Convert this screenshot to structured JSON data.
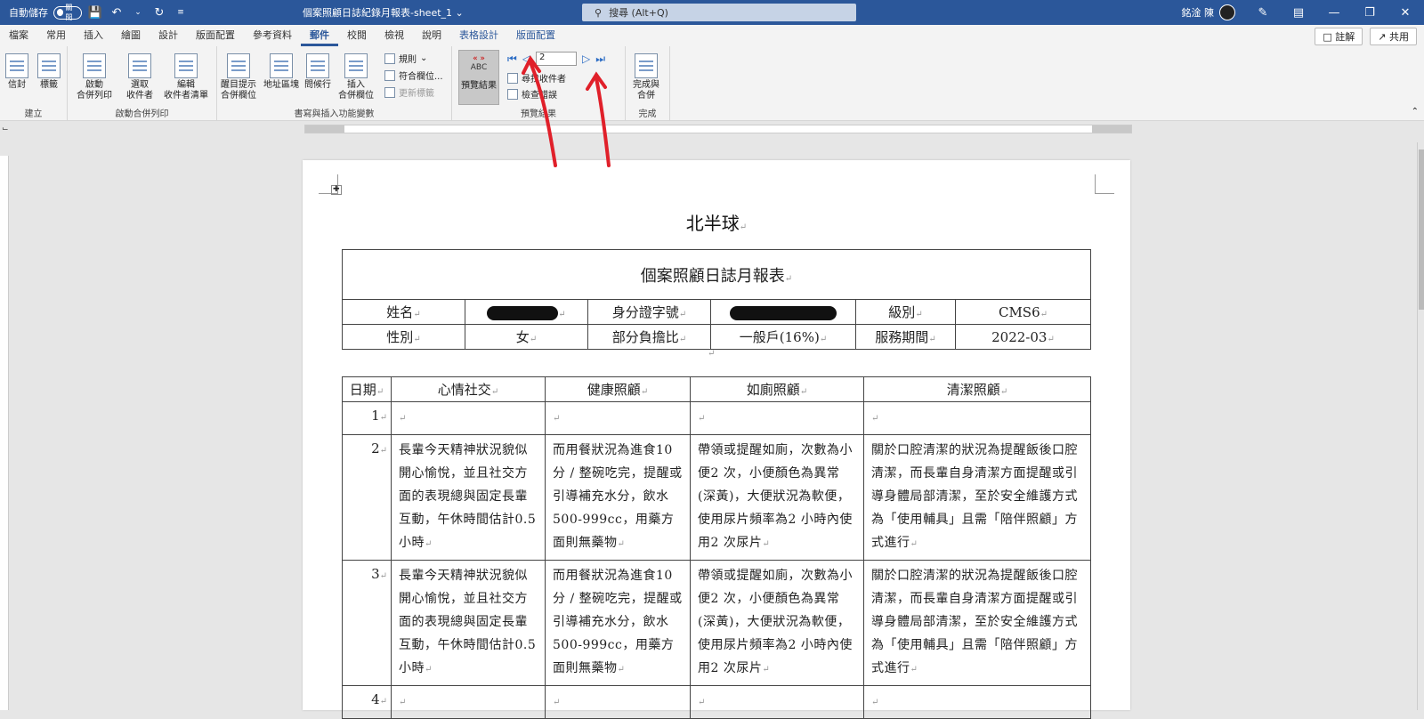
{
  "titlebar": {
    "autosave_label": "自動儲存",
    "autosave_state": "關閉",
    "doc_title": "個案照顧日誌紀錄月報表-sheet_1",
    "search_placeholder": "搜尋 (Alt+Q)",
    "user_name": "銘淦 陳",
    "bg_color": "#2b579a"
  },
  "menu": {
    "items": [
      "檔案",
      "常用",
      "插入",
      "繪圖",
      "設計",
      "版面配置",
      "參考資料",
      "郵件",
      "校閱",
      "檢視",
      "說明",
      "表格設計",
      "版面配置"
    ],
    "active_index": 7,
    "comment_label": "註解",
    "share_label": "共用"
  },
  "ribbon": {
    "create": {
      "label": "建立",
      "envelope": "信封",
      "labels": "標籤"
    },
    "start": {
      "label": "啟動合併列印",
      "start_merge": "啟動\n合併列印",
      "select_recipients": "選取\n收件者",
      "edit_list": "編輯\n收件者清單"
    },
    "fields": {
      "label": "書寫與插入功能變數",
      "highlight": "醒目提示\n合併欄位",
      "address_block": "地址區塊",
      "greeting": "問候行",
      "insert_field": "插入\n合併欄位",
      "rules": "規則",
      "match_fields": "符合欄位...",
      "update_labels": "更新標籤"
    },
    "preview": {
      "label": "預覽結果",
      "preview_button": "預覽結果",
      "record_value": "2",
      "find_recipient": "尋找收件者",
      "check_errors": "檢查錯誤"
    },
    "finish": {
      "label": "完成",
      "finish_merge": "完成與\n合併"
    }
  },
  "document": {
    "heading": "北半球",
    "table1": {
      "title": "個案照顧日誌月報表",
      "row1": {
        "name_label": "姓名",
        "id_label": "身分證字號",
        "level_label": "級別",
        "level_value": "CMS6"
      },
      "row2": {
        "gender_label": "性別",
        "gender_value": "女",
        "copay_label": "部分負擔比",
        "copay_value": "一般戶(16%)",
        "period_label": "服務期間",
        "period_value": "2022-03"
      }
    },
    "table2": {
      "headers": [
        "日期",
        "心情社交",
        "健康照顧",
        "如廁照顧",
        "清潔照顧"
      ],
      "rows": [
        {
          "day": "1",
          "mood": "",
          "health": "",
          "toilet": "",
          "clean": ""
        },
        {
          "day": "2",
          "mood": "長輩今天精神狀況貌似開心愉悅，並且社交方面的表現總與固定長輩互動，午休時間估計0.5 小時",
          "health": "而用餐狀況為進食10分 / 整碗吃完，提醒或引導補充水分，飲水500-999cc，用藥方面則無藥物",
          "toilet": "帶領或提醒如廁，次數為小便2 次，小便顏色為異常(深黃)，大便狀況為軟便，使用尿片頻率為2 小時內使用2 次尿片",
          "clean": "關於口腔清潔的狀況為提醒飯後口腔清潔，而長輩自身清潔方面提醒或引導身體局部清潔，至於安全維護方式為「使用輔具」且需「陪伴照顧」方式進行"
        },
        {
          "day": "3",
          "mood": "長輩今天精神狀況貌似開心愉悅，並且社交方面的表現總與固定長輩互動，午休時間估計0.5 小時",
          "health": "而用餐狀況為進食10分 / 整碗吃完，提醒或引導補充水分，飲水500-999cc，用藥方面則無藥物",
          "toilet": "帶領或提醒如廁，次數為小便2 次，小便顏色為異常(深黃)，大便狀況為軟便，使用尿片頻率為2 小時內使用2 次尿片",
          "clean": "關於口腔清潔的狀況為提醒飯後口腔清潔，而長輩自身清潔方面提醒或引導身體局部清潔，至於安全維護方式為「使用輔具」且需「陪伴照顧」方式進行"
        },
        {
          "day": "4",
          "mood": "",
          "health": "",
          "toilet": "",
          "clean": ""
        }
      ]
    }
  },
  "annotation_color": "#e0202a"
}
